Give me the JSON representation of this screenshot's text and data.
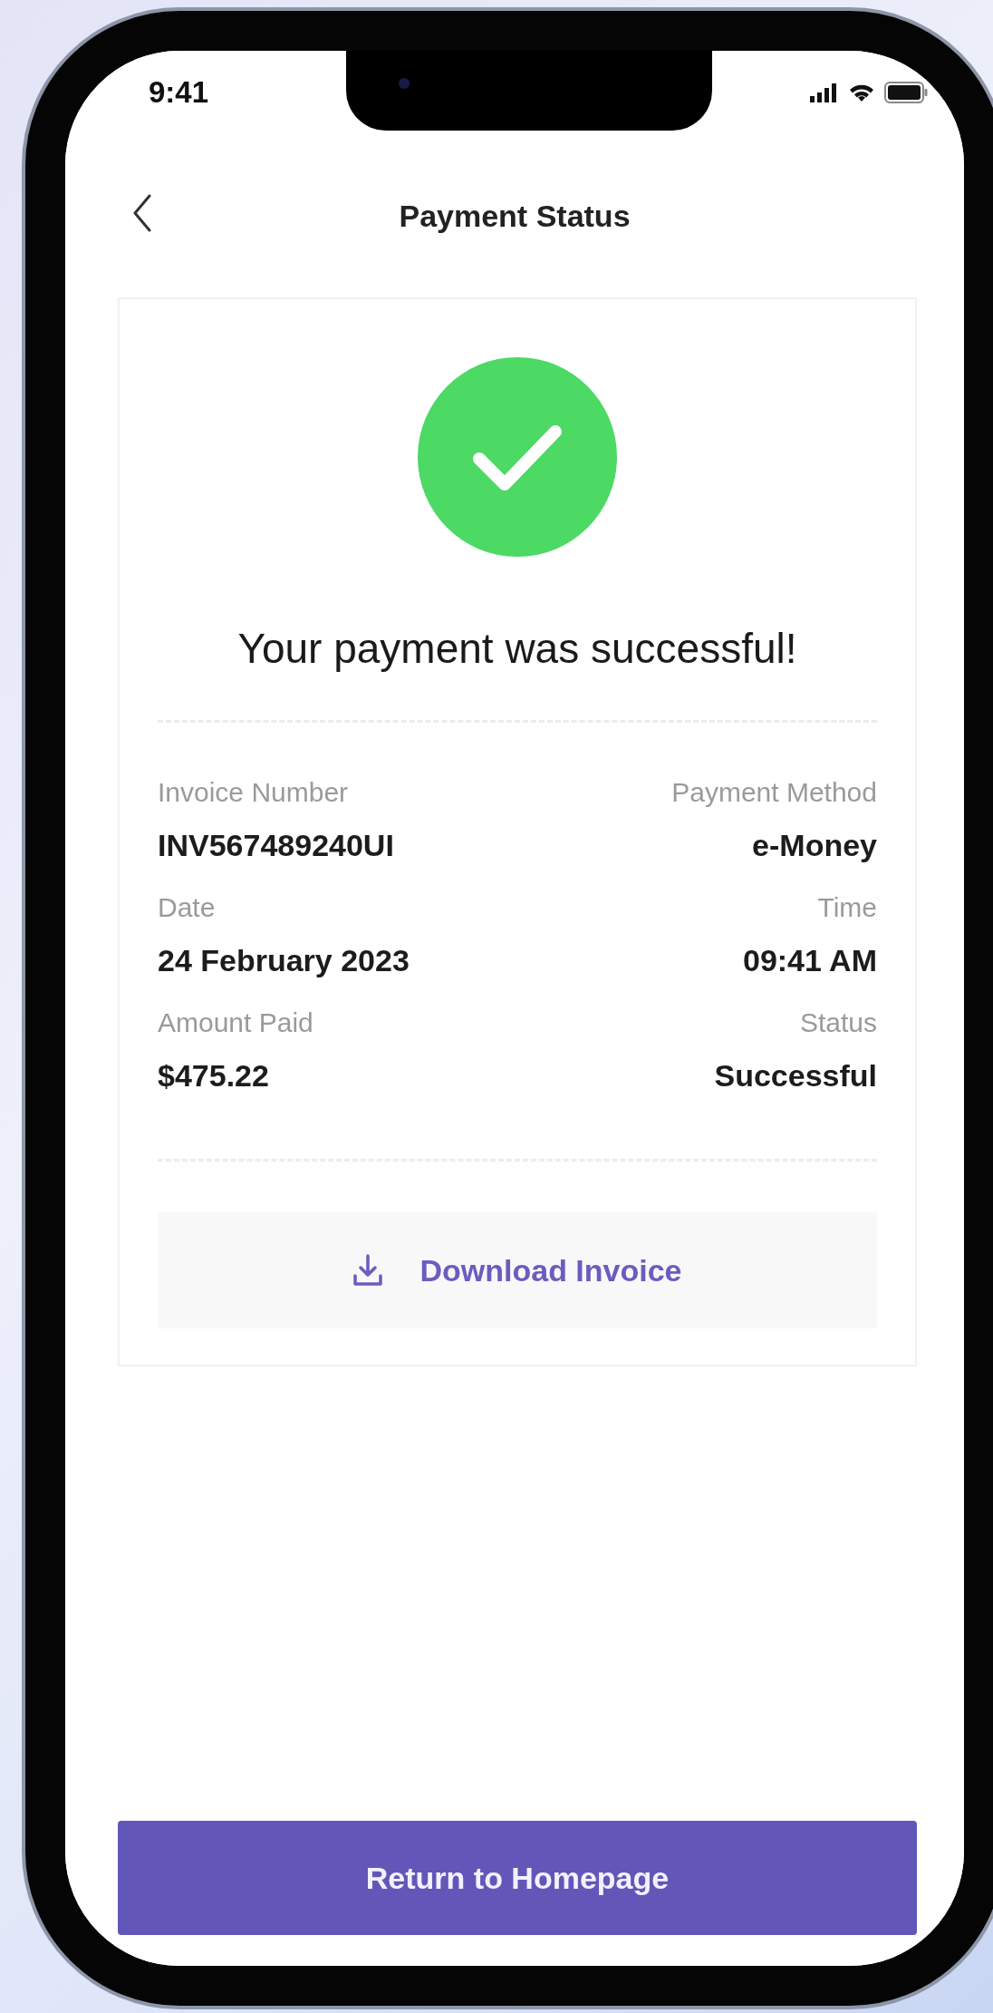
{
  "status_bar": {
    "time": "9:41"
  },
  "header": {
    "title": "Payment Status"
  },
  "result": {
    "message": "Your payment was successful!"
  },
  "details": [
    {
      "left": {
        "label": "Invoice Number",
        "value": "INV567489240UI"
      },
      "right": {
        "label": "Payment Method",
        "value": "e-Money"
      }
    },
    {
      "left": {
        "label": "Date",
        "value": "24 February 2023"
      },
      "right": {
        "label": "Time",
        "value": "09:41 AM"
      }
    },
    {
      "left": {
        "label": "Amount Paid",
        "value": "$475.22"
      },
      "right": {
        "label": "Status",
        "value": "Successful"
      }
    }
  ],
  "download_button": {
    "label": "Download Invoice"
  },
  "primary_button": {
    "label": "Return to Homepage"
  }
}
